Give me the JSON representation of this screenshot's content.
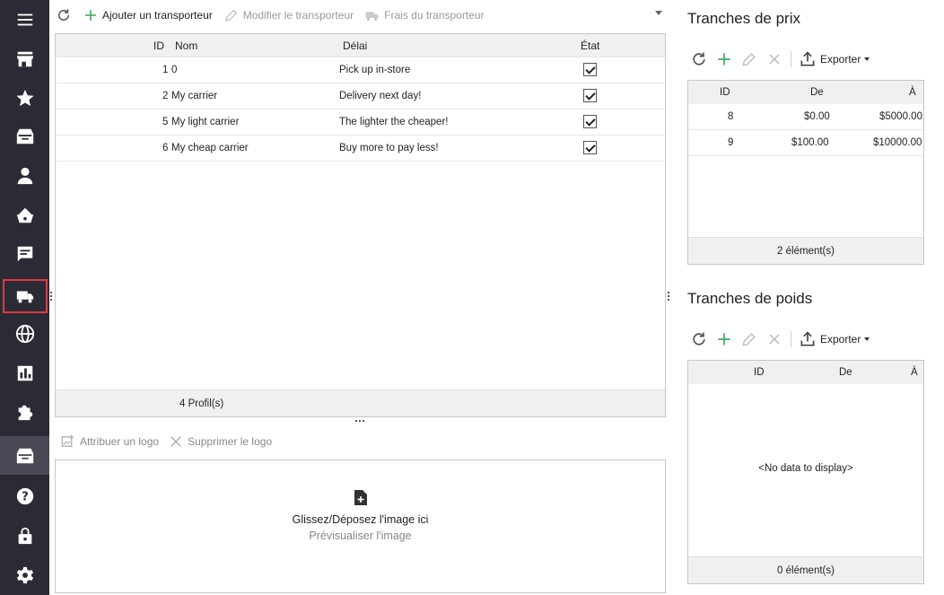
{
  "toolbar": {
    "add_label": "Ajouter un transporteur",
    "edit_label": "Modifier le transporteur",
    "fees_label": "Frais du transporteur"
  },
  "carriers": {
    "columns": {
      "id": "ID",
      "name": "Nom",
      "delay": "Délai",
      "state": "État"
    },
    "rows": [
      {
        "id": "1",
        "name": "0",
        "delay": "Pick up in-store",
        "active": true
      },
      {
        "id": "2",
        "name": "My carrier",
        "delay": "Delivery next day!",
        "active": true
      },
      {
        "id": "5",
        "name": "My light carrier",
        "delay": "The lighter the cheaper!",
        "active": true
      },
      {
        "id": "6",
        "name": "My cheap carrier",
        "delay": "Buy more to pay less!",
        "active": true
      }
    ],
    "footer": "4 Profil(s)"
  },
  "logo": {
    "assign_label": "Attribuer un logo",
    "delete_label": "Supprimer le logo",
    "drop_text": "Glissez/Déposez l'image ici",
    "preview_text": "Prévisualiser l'image"
  },
  "price_ranges": {
    "title": "Tranches de prix",
    "export_label": "Exporter",
    "columns": {
      "id": "ID",
      "from": "De",
      "to": "À"
    },
    "rows": [
      {
        "id": "8",
        "from": "$0.00",
        "to": "$5000.00"
      },
      {
        "id": "9",
        "from": "$100.00",
        "to": "$10000.00"
      }
    ],
    "footer": "2 élément(s)"
  },
  "weight_ranges": {
    "title": "Tranches de poids",
    "export_label": "Exporter",
    "columns": {
      "id": "ID",
      "from": "De",
      "to": "À"
    },
    "empty_text": "<No data to display>",
    "footer": "0 élément(s)"
  },
  "sidebar": {
    "items": [
      "menu-icon",
      "store-icon",
      "star-icon",
      "inbox-icon",
      "person-icon",
      "basket-icon",
      "message-icon",
      "truck-icon",
      "globe-icon",
      "chart-icon",
      "puzzle-icon",
      "archive-icon",
      "help-icon",
      "lock-icon",
      "gear-icon"
    ]
  },
  "colors": {
    "sidebar_bg": "#2b2b36",
    "highlight": "#e0393e",
    "accent_green": "#3aa757"
  }
}
